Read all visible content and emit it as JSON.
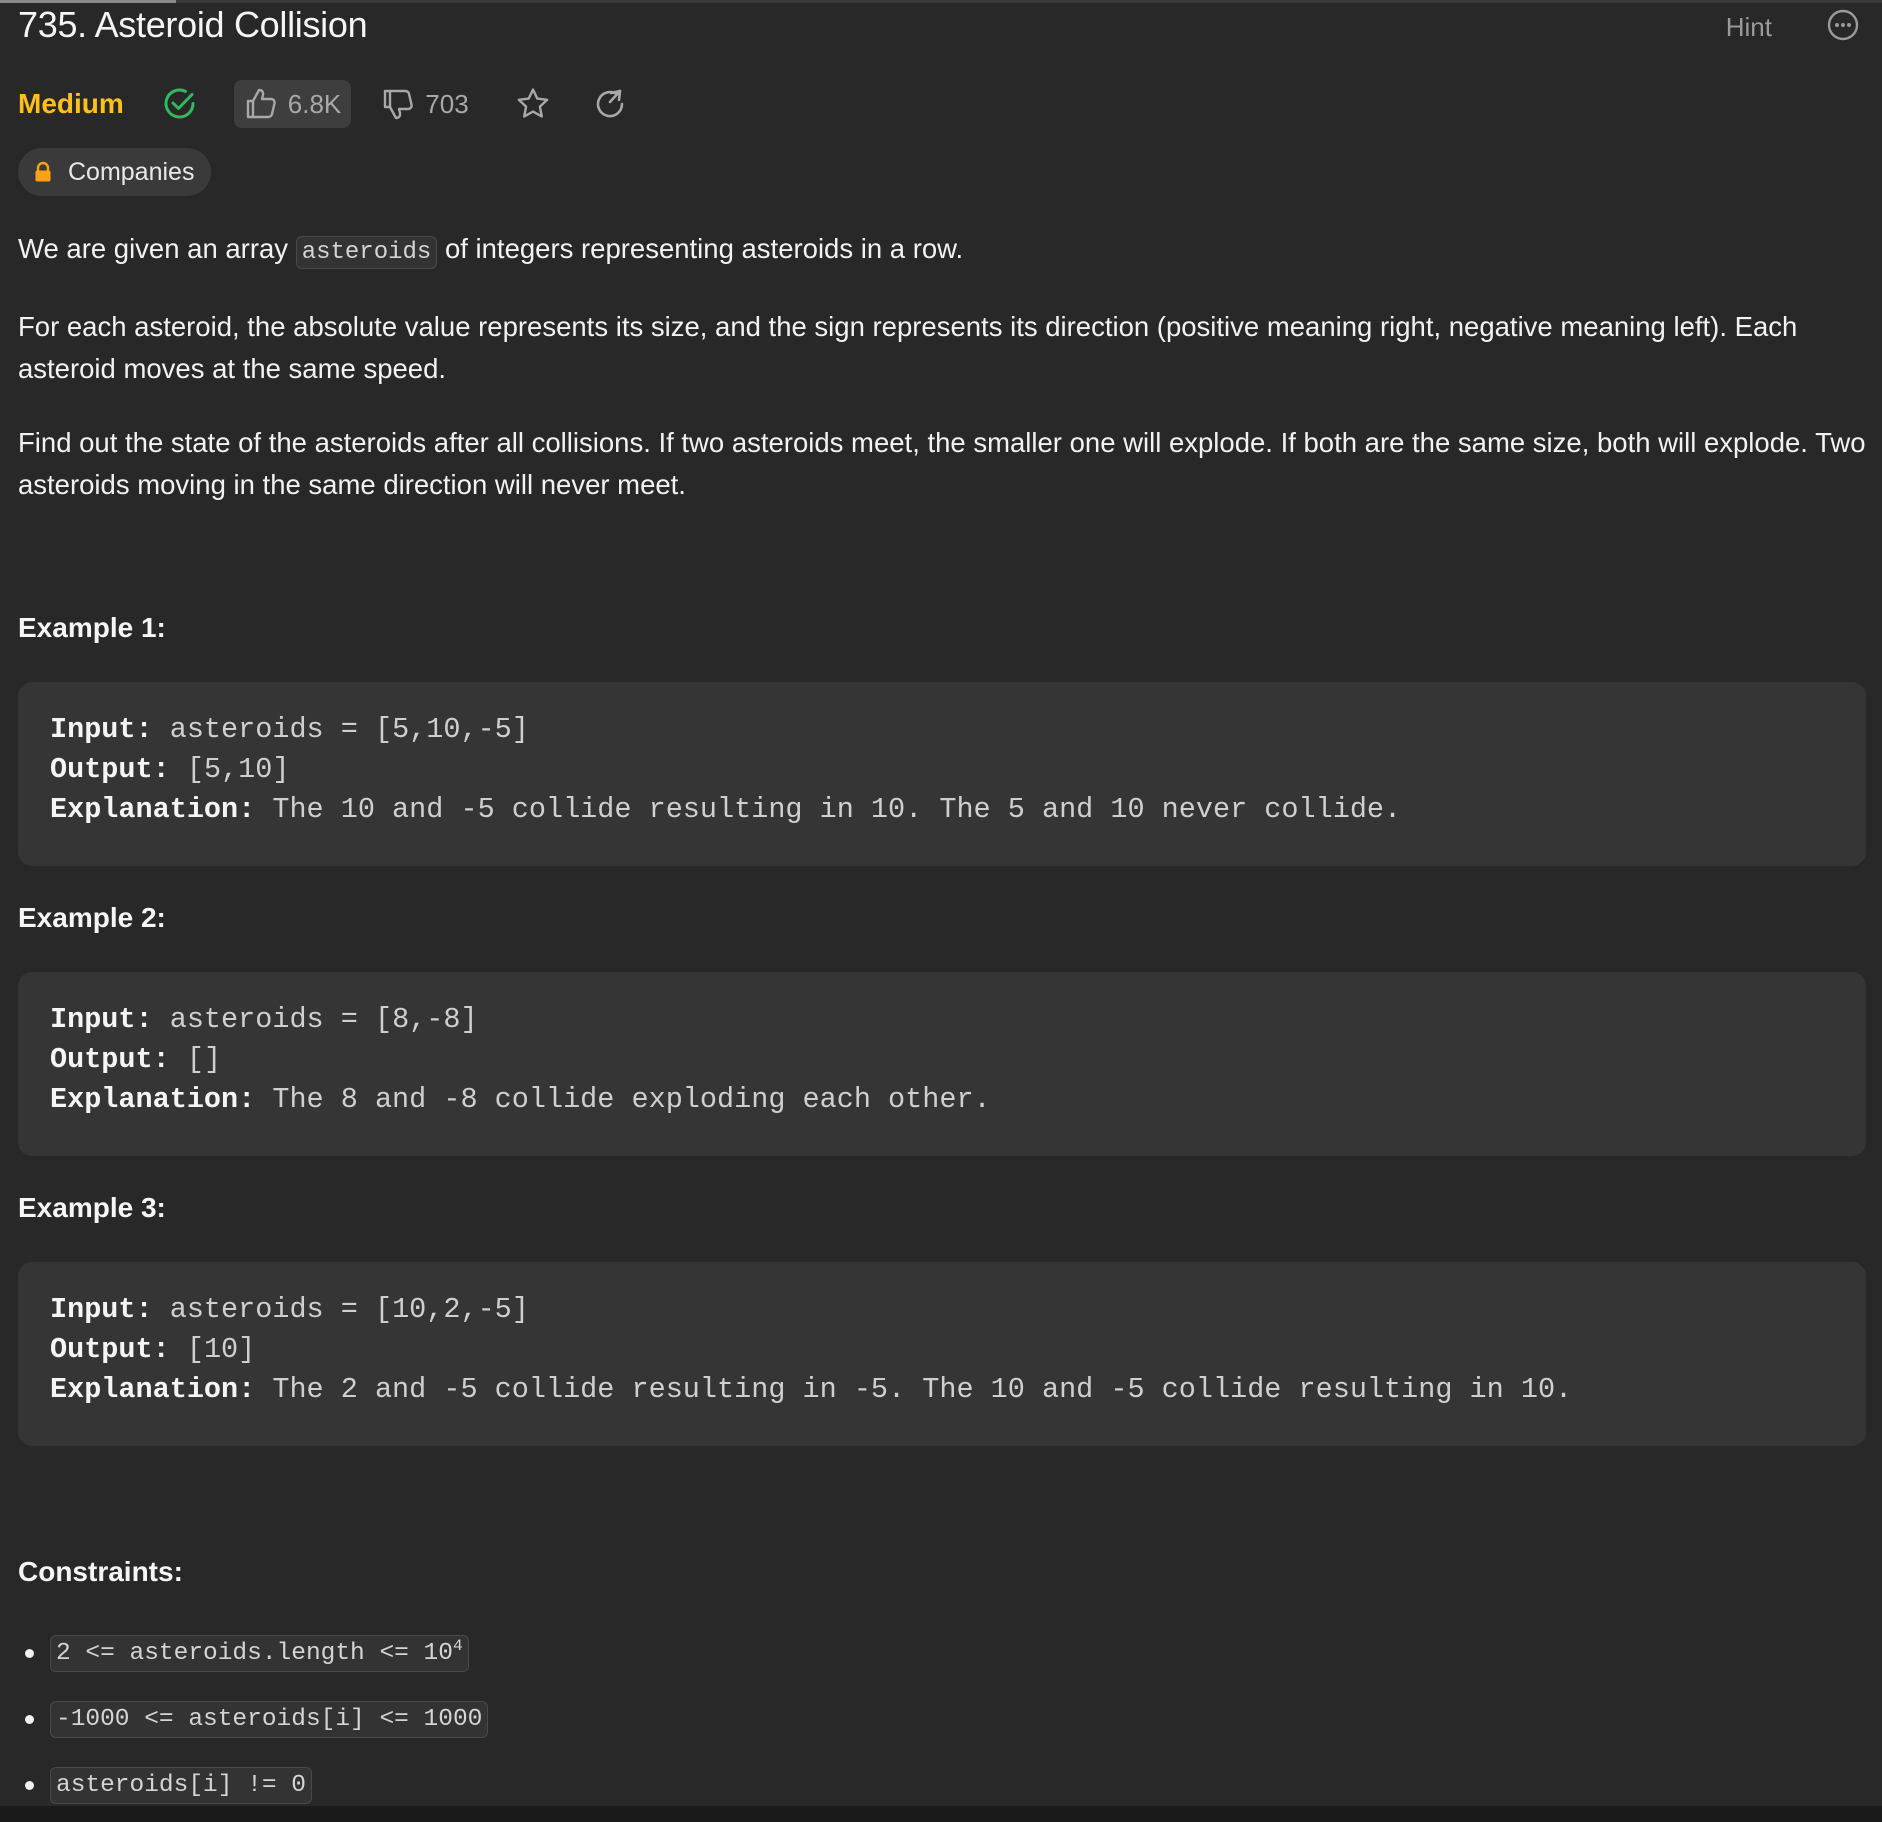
{
  "problem": {
    "title": "735. Asteroid Collision",
    "hint_label": "Hint",
    "difficulty": "Medium",
    "likes": "6.8K",
    "dislikes": "703",
    "companies_label": "Companies",
    "colors": {
      "difficulty": "#ffc01e",
      "solved_check": "#2cbb5d",
      "lock": "#ffa116"
    }
  },
  "description": {
    "p1_before": "We are given an array ",
    "p1_code": "asteroids",
    "p1_after": " of integers representing asteroids in a row.",
    "p2": "For each asteroid, the absolute value represents its size, and the sign represents its direction (positive meaning right, negative meaning left). Each asteroid moves at the same speed.",
    "p3": "Find out the state of the asteroids after all collisions. If two asteroids meet, the smaller one will explode. If both are the same size, both will explode. Two asteroids moving in the same direction will never meet."
  },
  "examples": [
    {
      "heading": "Example 1:",
      "input_label": "Input:",
      "input": " asteroids = [5,10,-5]",
      "output_label": "Output:",
      "output": " [5,10]",
      "explanation_label": "Explanation:",
      "explanation": " The 10 and -5 collide resulting in 10. The 5 and 10 never collide."
    },
    {
      "heading": "Example 2:",
      "input_label": "Input:",
      "input": " asteroids = [8,-8]",
      "output_label": "Output:",
      "output": " []",
      "explanation_label": "Explanation:",
      "explanation": " The 8 and -8 collide exploding each other."
    },
    {
      "heading": "Example 3:",
      "input_label": "Input:",
      "input": " asteroids = [10,2,-5]",
      "output_label": "Output:",
      "output": " [10]",
      "explanation_label": "Explanation:",
      "explanation": " The 2 and -5 collide resulting in -5. The 10 and -5 collide resulting in 10."
    }
  ],
  "constraints": {
    "heading": "Constraints:",
    "c1_base": "2 <= asteroids.length <= 10",
    "c1_exp": "4",
    "c2": "-1000 <= asteroids[i] <= 1000",
    "c3": "asteroids[i] != 0"
  },
  "icons": {
    "more": "more-options-icon",
    "check": "check-circle-icon",
    "like": "thumbs-up-icon",
    "dislike": "thumbs-down-icon",
    "star": "star-icon",
    "share": "share-icon",
    "lock": "lock-icon"
  }
}
